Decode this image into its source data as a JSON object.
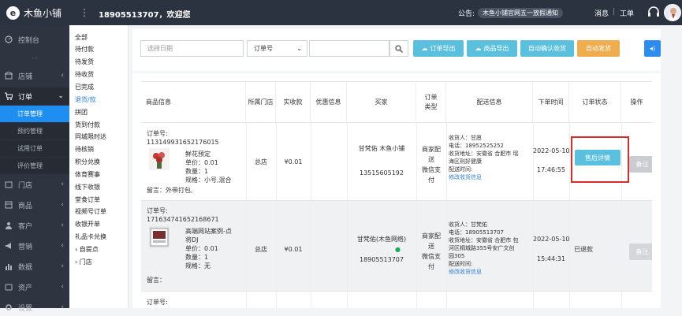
{
  "header": {
    "logo_text": "木鱼小铺",
    "menu_icon": "vertical-dots-icon",
    "welcome": "18905513707，欢迎您",
    "notice_label": "公告:",
    "notice_text": "木鱼小铺官网五一放假通知",
    "messages": "消息",
    "separator": "|",
    "tickets": "工单"
  },
  "sidebar": {
    "items": [
      {
        "label": "控制台",
        "icon": "gauge-icon"
      },
      {
        "label": "...",
        "icon": ""
      },
      {
        "label": "店铺",
        "icon": "store-icon"
      },
      {
        "label": "订单",
        "icon": "cart-icon"
      },
      {
        "label": "门店",
        "icon": "shop-icon"
      },
      {
        "label": "商品",
        "icon": "box-icon"
      },
      {
        "label": "客户",
        "icon": "users-icon"
      },
      {
        "label": "营销",
        "icon": "megaphone-icon"
      },
      {
        "label": "数据",
        "icon": "chart-icon"
      },
      {
        "label": "资产",
        "icon": "asset-icon"
      },
      {
        "label": "设置",
        "icon": "gear-icon"
      }
    ],
    "order_sub": [
      "订单管理",
      "预约管理",
      "试用订单",
      "评价管理"
    ]
  },
  "subnav": {
    "items": [
      "全部",
      "待付款",
      "待发货",
      "待收货",
      "已完成",
      "退货/款",
      "拼团",
      "货到付款",
      "同城限时达",
      "待核销",
      "积分兑换",
      "体育赛事",
      "线下收银",
      "堂食订单",
      "视频号订单",
      "收银开单",
      "礼品卡兑换"
    ],
    "tree": [
      "自提点",
      "门店"
    ],
    "active": "退货/款"
  },
  "filter": {
    "date_placeholder": "选择日期",
    "select_value": "订单号",
    "buttons": {
      "export_orders": "订单导出",
      "export_goods": "商品导出",
      "auto_confirm": "自动确认收货",
      "auto_ship": "自动发货"
    },
    "colors": {
      "teal": "#5bc0de",
      "gold": "#f0ad4e",
      "blue": "#2d8cf0"
    }
  },
  "table": {
    "headers": [
      "商品信息",
      "所属门店",
      "实收款",
      "优惠信息",
      "买家",
      "订单类型",
      "配送信息",
      "下单时间",
      "订单状态",
      "操作"
    ],
    "rows": [
      {
        "order_label": "订单号:",
        "order_no": "113149931652176015",
        "product_name": "鲜花预定",
        "unit_price": "单价：0.01",
        "quantity": "数量：1",
        "spec": "规格：小号,混合",
        "remark": "留言：外带打包,",
        "store": "总店",
        "paid": "¥0.01",
        "buyer_name": "甘梵佑 木鱼小铺",
        "buyer_phone": "13515605192",
        "order_type_1": "商家配送",
        "order_type_2": "微信支付",
        "receiver": "收货人：甘愿",
        "phone": "电话：18952525252",
        "address_1": "收货地址：安徽省 合肥市 瑶",
        "address_2": "海区刑好健康",
        "delivery_time": "配送时间:",
        "edit_link": "修改收货信息",
        "date": "2022-05-10",
        "time": "17:46:55",
        "status_button": "售后详情",
        "action": "备注"
      },
      {
        "order_label": "订单号:",
        "order_no": "171634741652168671",
        "product_name_1": "高端网站案例-点",
        "product_name_2": "将DJ",
        "unit_price": "单价：0.01",
        "quantity": "数量：1",
        "spec": "规格：无",
        "remark": "留言：",
        "store": "总店",
        "paid": "¥0.01",
        "buyer_name": "甘梵佑(木鱼网络)",
        "buyer_phone": "18905513707",
        "order_type_1": "商家配送",
        "order_type_2": "微信支付",
        "receiver": "收货人：甘梵佑",
        "phone": "电话：18905513707",
        "address_1": "收货地址：安徽省 合肥市 包",
        "address_2": "河区桐城路355号安广文创",
        "address_3": "园305",
        "delivery_time": "配送时间:",
        "edit_link": "修改收货信息",
        "date": "2022-05-10",
        "time": "15:44:31",
        "status": "已退款",
        "action": "备注"
      },
      {
        "order_label": "订单号:"
      }
    ]
  }
}
